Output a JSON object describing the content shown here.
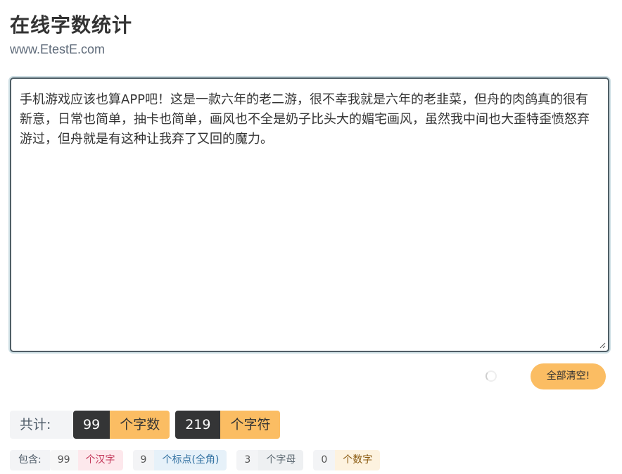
{
  "header": {
    "title": "在线字数统计",
    "site": "www.EtestE.com"
  },
  "editor": {
    "text": "手机游戏应该也算APP吧！这是一款六年的老二游，很不幸我就是六年的老韭菜，但舟的肉鸽真的很有新意，日常也简单，抽卡也简单，画风也不全是奶子比头大的媚宅画风，虽然我中间也大歪特歪愤怒弃游过，但舟就是有这种让我弃了又回的魔力。"
  },
  "actions": {
    "clear_label": "全部清空!"
  },
  "totals": {
    "label": "共计:",
    "words_count": "99",
    "words_unit": "个字数",
    "chars_count": "219",
    "chars_unit": "个字符"
  },
  "breakdown": {
    "label": "包含:",
    "items": [
      {
        "count": "99",
        "unit": "个汉字"
      },
      {
        "count": "9",
        "unit": "个标点(全角)"
      },
      {
        "count": "3",
        "unit": "个字母"
      },
      {
        "count": "0",
        "unit": "个数字"
      }
    ]
  },
  "colors": {
    "accent": "#fbbd63",
    "dark_badge": "#343536",
    "editor_border": "#4f5e66"
  },
  "icons": {
    "spinner": "loading-spinner-icon",
    "resize": "resize-grip-icon"
  }
}
